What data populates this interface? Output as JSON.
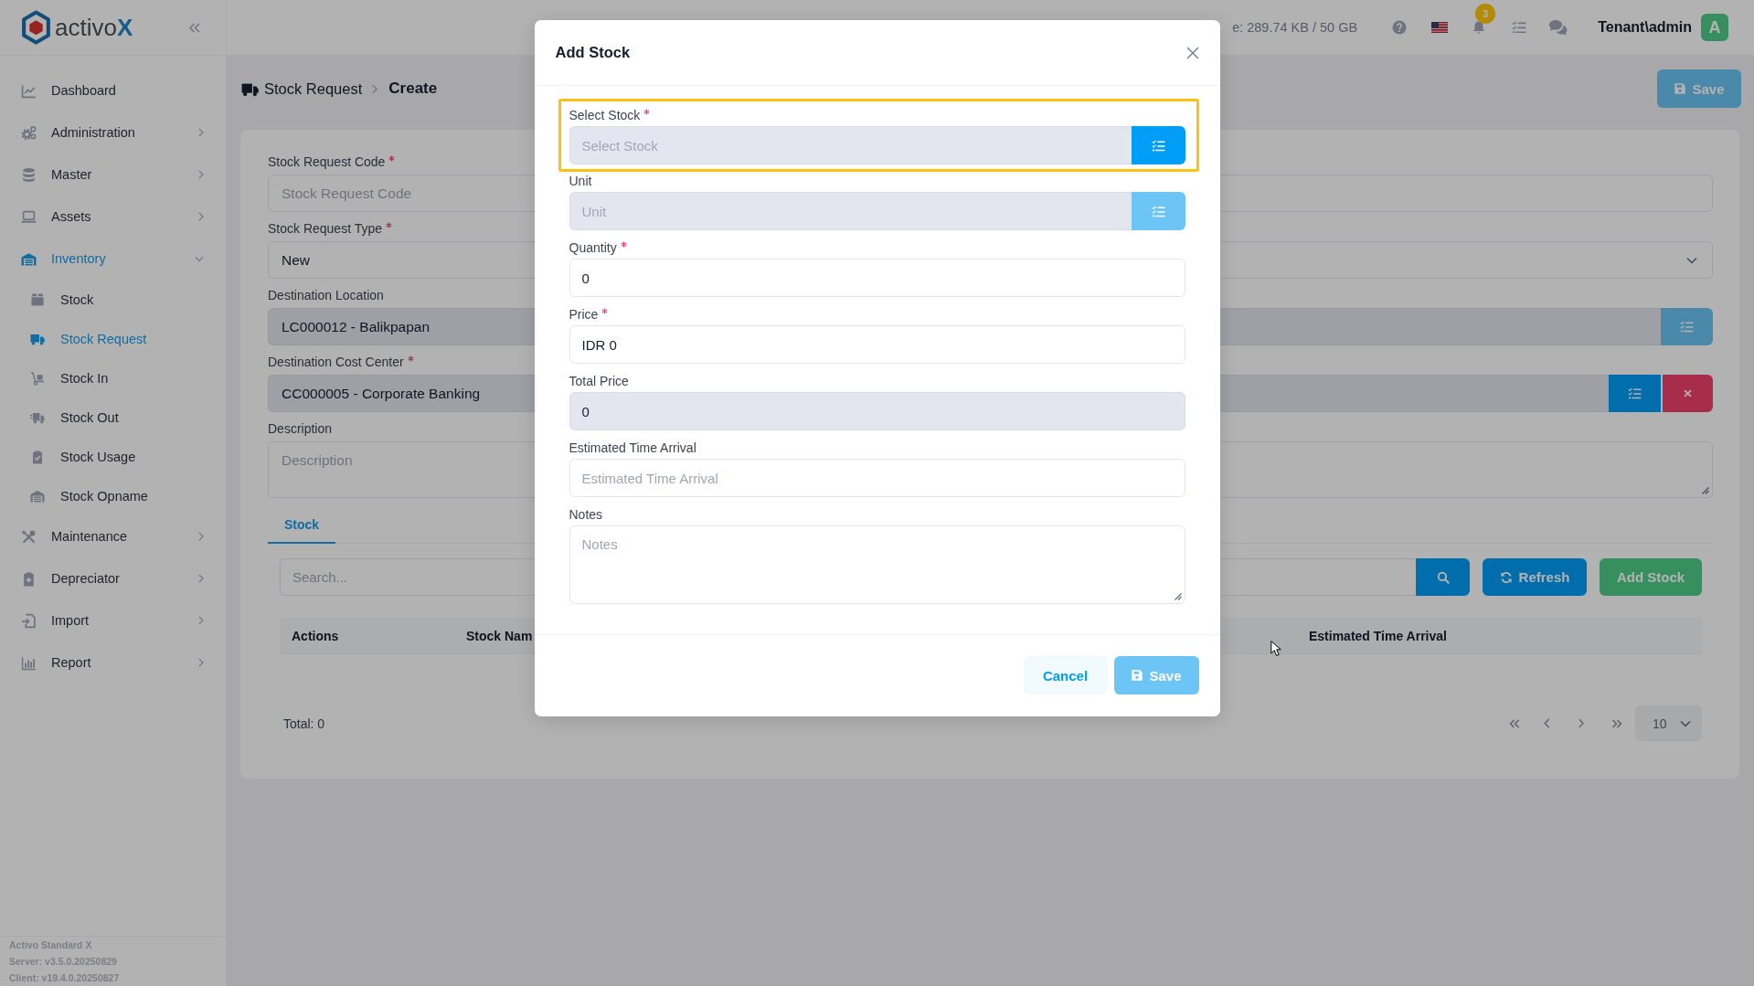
{
  "sidebar": {
    "logo": {
      "text": "activo",
      "accent": "X"
    },
    "items": [
      {
        "label": "Dashboard",
        "kind": "link",
        "selected": false
      },
      {
        "label": "Administration",
        "kind": "group",
        "selected": false,
        "expanded": false
      },
      {
        "label": "Master",
        "kind": "group",
        "selected": false,
        "expanded": false
      },
      {
        "label": "Assets",
        "kind": "group",
        "selected": false,
        "expanded": false
      },
      {
        "label": "Inventory",
        "kind": "group",
        "selected": true,
        "expanded": true,
        "children": [
          {
            "label": "Stock",
            "selected": false
          },
          {
            "label": "Stock Request",
            "selected": true
          },
          {
            "label": "Stock In",
            "selected": false
          },
          {
            "label": "Stock Out",
            "selected": false
          },
          {
            "label": "Stock Usage",
            "selected": false
          },
          {
            "label": "Stock Opname",
            "selected": false
          }
        ]
      },
      {
        "label": "Maintenance",
        "kind": "group",
        "selected": false,
        "expanded": false
      },
      {
        "label": "Depreciator",
        "kind": "group",
        "selected": false,
        "expanded": false
      },
      {
        "label": "Import",
        "kind": "group",
        "selected": false,
        "expanded": false
      },
      {
        "label": "Report",
        "kind": "group",
        "selected": false,
        "expanded": false
      }
    ],
    "footer": [
      "Activo Standard X",
      "Server: v3.5.0.20250829",
      "Client: v19.4.0.20250827"
    ]
  },
  "topbar": {
    "storage": "e: 289.74 KB / 50 GB",
    "notification_count": "3",
    "user": "Tenant\\admin",
    "avatar_initial": "A"
  },
  "breadcrumb": [
    {
      "label": "Stock Request",
      "current": false
    },
    {
      "label": "Create",
      "current": true
    }
  ],
  "header_button": {
    "label": "Save",
    "disabled": true
  },
  "form": {
    "fields": [
      {
        "label": "Stock Request Code",
        "kind": "text",
        "required": true,
        "readonly": false,
        "placeholder": "Stock Request Code"
      },
      {
        "label": "Stock Request Type",
        "kind": "select",
        "required": true,
        "readonly": false,
        "value": "New"
      },
      {
        "label": "Destination Location",
        "kind": "lookup",
        "required": false,
        "readonly": true,
        "value": "LC000012 - Balikpapan",
        "button_disabled": true,
        "clearable": false
      },
      {
        "label": "Destination Cost Center",
        "kind": "lookup",
        "required": true,
        "readonly": true,
        "value": "CC000005 - Corporate Banking",
        "button_disabled": false,
        "clearable": true
      },
      {
        "label": "Description",
        "kind": "textarea",
        "required": false,
        "readonly": false,
        "placeholder": "Description"
      }
    ]
  },
  "tabs": [
    {
      "label": "Stock",
      "selected": true
    }
  ],
  "stock_toolbar": {
    "search_placeholder": "Search...",
    "buttons": [
      {
        "kind": "refresh",
        "label": "Refresh"
      },
      {
        "kind": "add",
        "label": "Add Stock"
      }
    ]
  },
  "table": {
    "columns": [
      "Actions",
      "Stock Nam",
      "Estimated Time Arrival"
    ]
  },
  "pagination": {
    "total": "Total: 0",
    "page_size": "10"
  },
  "modal": {
    "title": "Add Stock",
    "fields": [
      {
        "label": "Select Stock",
        "kind": "lookup",
        "required": true,
        "readonly": true,
        "highlighted": true,
        "placeholder": "Select Stock",
        "button_disabled": false,
        "clearable": false
      },
      {
        "label": "Unit",
        "kind": "lookup",
        "required": false,
        "readonly": true,
        "highlighted": false,
        "placeholder": "Unit",
        "button_disabled": true,
        "clearable": false
      },
      {
        "label": "Quantity",
        "kind": "text",
        "required": true,
        "readonly": false,
        "highlighted": false,
        "value": "0"
      },
      {
        "label": "Price",
        "kind": "text",
        "required": true,
        "readonly": false,
        "highlighted": false,
        "value": "IDR 0"
      },
      {
        "label": "Total Price",
        "kind": "text",
        "required": false,
        "readonly": true,
        "highlighted": false,
        "value": "0"
      },
      {
        "label": "Estimated Time Arrival",
        "kind": "text",
        "required": false,
        "readonly": false,
        "highlighted": false,
        "placeholder": "Estimated Time Arrival"
      },
      {
        "label": "Notes",
        "kind": "textarea",
        "required": false,
        "readonly": false,
        "highlighted": false,
        "placeholder": "Notes"
      }
    ],
    "buttons": [
      {
        "kind": "cancel",
        "label": "Cancel",
        "disabled": false
      },
      {
        "kind": "save",
        "label": "Save",
        "disabled": true
      }
    ]
  }
}
